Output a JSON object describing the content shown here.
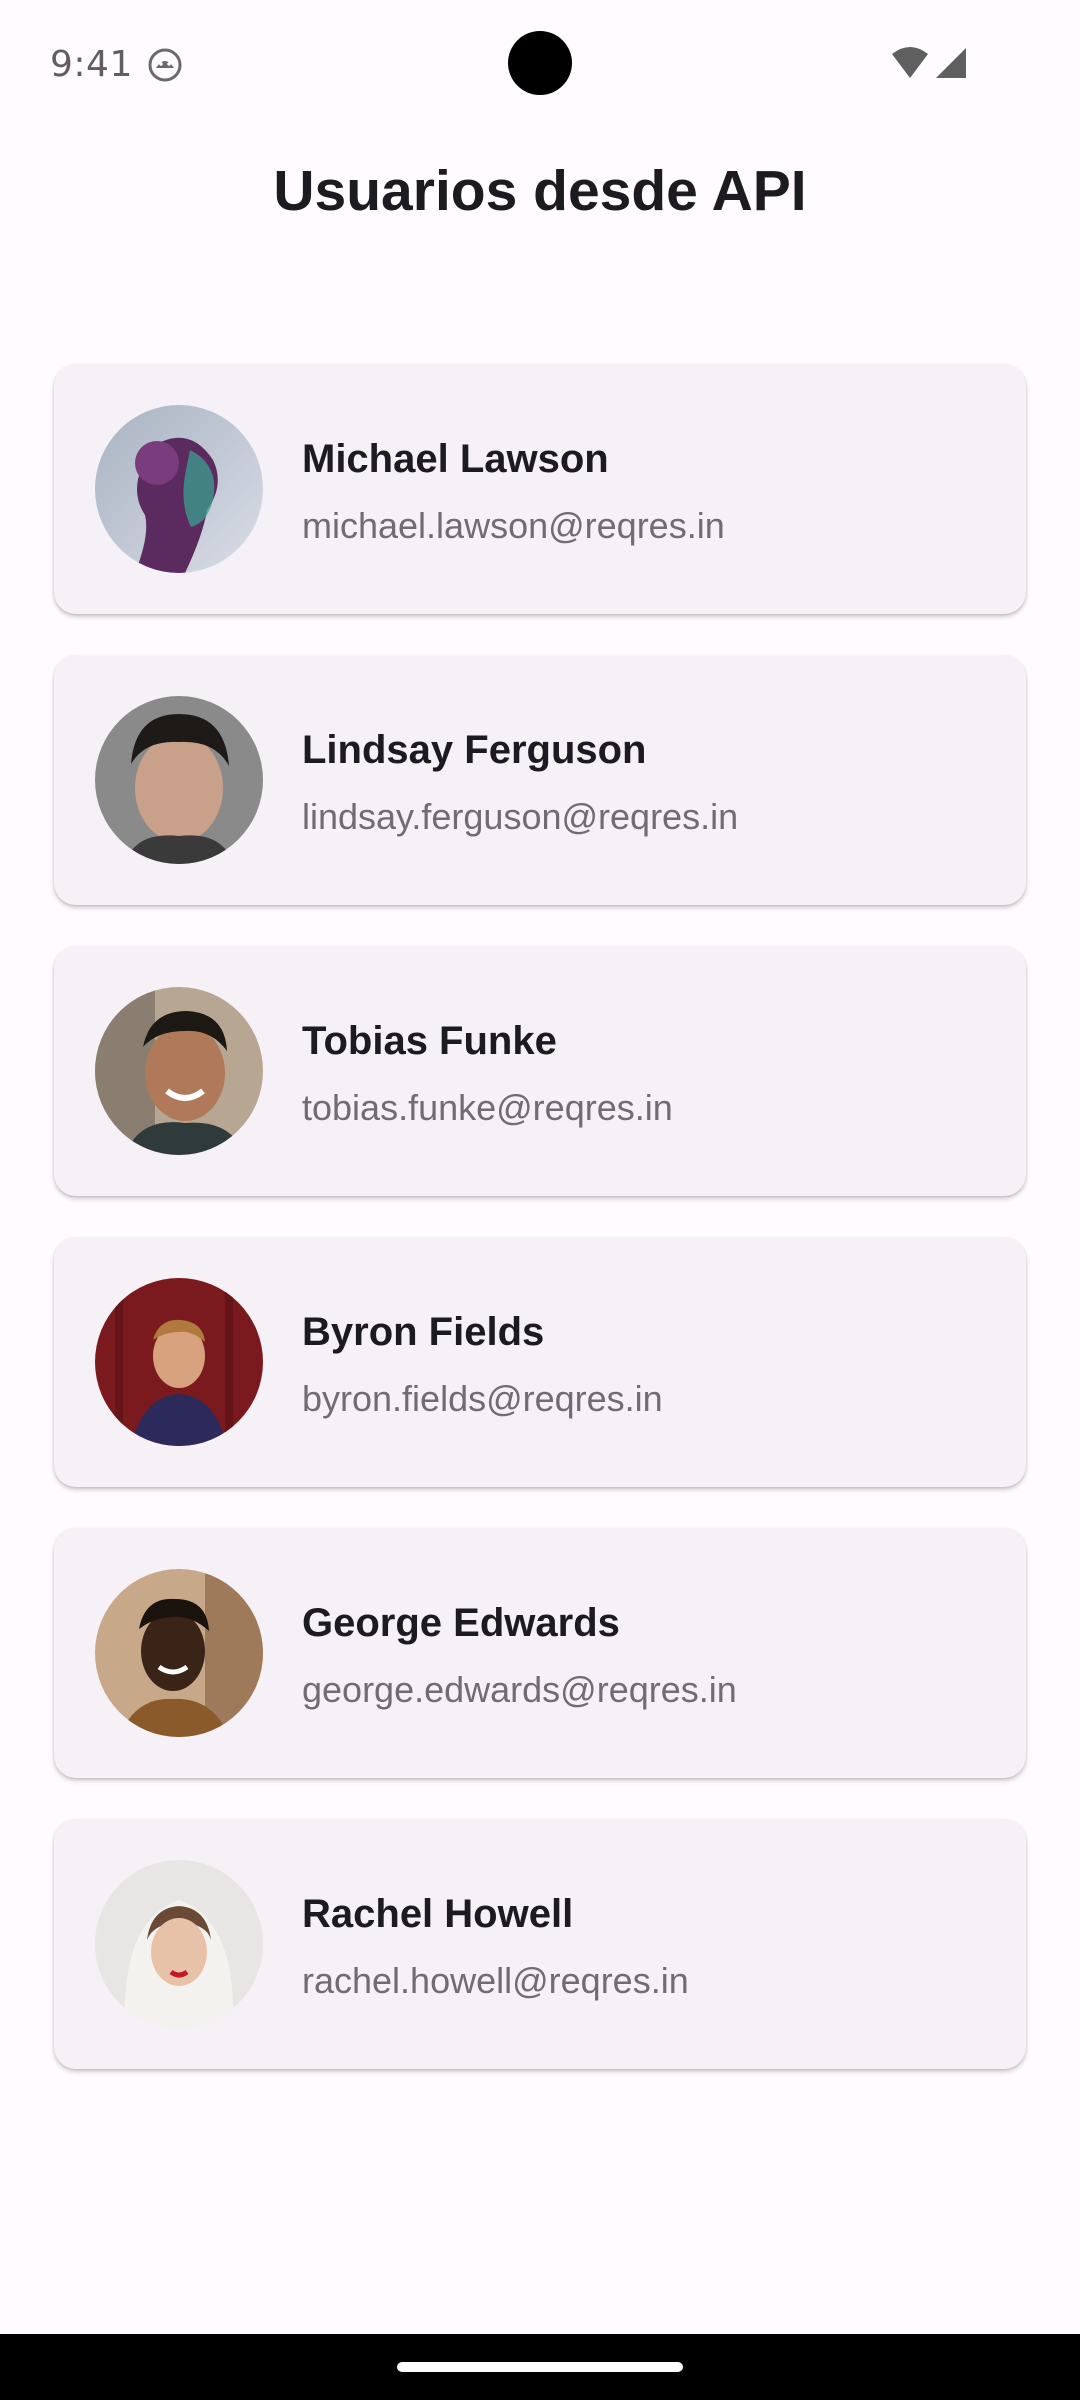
{
  "status_bar": {
    "time": "9:41",
    "app_icon": "android-robot-icon",
    "wifi_icon": "wifi-icon",
    "signal_icon": "cell-signal-icon"
  },
  "header": {
    "title": "Usuarios desde API"
  },
  "users": [
    {
      "name": "Michael Lawson",
      "email": "michael.lawson@reqres.in",
      "avatar": "avatar-photo"
    },
    {
      "name": "Lindsay Ferguson",
      "email": "lindsay.ferguson@reqres.in",
      "avatar": "avatar-photo"
    },
    {
      "name": "Tobias Funke",
      "email": "tobias.funke@reqres.in",
      "avatar": "avatar-photo"
    },
    {
      "name": "Byron Fields",
      "email": "byron.fields@reqres.in",
      "avatar": "avatar-photo"
    },
    {
      "name": "George Edwards",
      "email": "george.edwards@reqres.in",
      "avatar": "avatar-photo"
    },
    {
      "name": "Rachel Howell",
      "email": "rachel.howell@reqres.in",
      "avatar": "avatar-photo"
    }
  ],
  "colors": {
    "background": "#fffbfe",
    "card_background": "#f6f0f7",
    "title_text": "#1c1b1f",
    "email_text": "#6f6d72",
    "nav_bar": "#000000"
  }
}
